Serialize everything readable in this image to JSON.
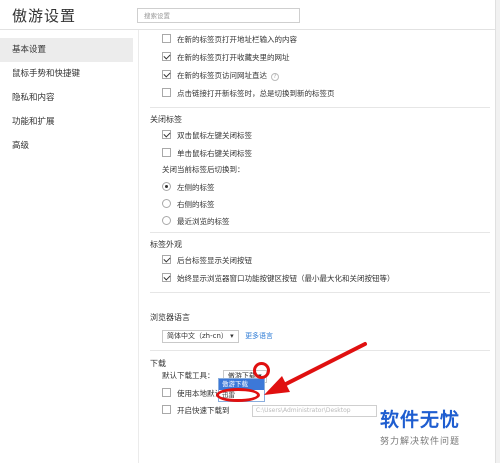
{
  "header": {
    "title": "傲游设置",
    "search_placeholder": "搜索设置"
  },
  "sidebar": {
    "items": [
      {
        "label": "基本设置"
      },
      {
        "label": "鼠标手势和快捷键"
      },
      {
        "label": "隐私和内容"
      },
      {
        "label": "功能和扩展"
      },
      {
        "label": "高级"
      }
    ]
  },
  "tabs_open": {
    "items": [
      {
        "label": "在新的标签页打开地址栏输入的内容",
        "checked": false
      },
      {
        "label": "在新的标签页打开收藏夹里的网址",
        "checked": true
      },
      {
        "label": "在新的标签页访问网址直达",
        "checked": true,
        "help": "?"
      },
      {
        "label": "点击链接打开新标签时，总是切换到新的标签页",
        "checked": false
      }
    ]
  },
  "close_tabs": {
    "title": "关闭标签",
    "items": [
      {
        "label": "双击鼠标左键关闭标签",
        "checked": true
      },
      {
        "label": "单击鼠标右键关闭标签",
        "checked": false
      }
    ],
    "switch_label": "关闭当前标签后切换到：",
    "radios": [
      {
        "label": "左侧的标签",
        "checked": true
      },
      {
        "label": "右侧的标签",
        "checked": false
      },
      {
        "label": "最近浏览的标签",
        "checked": false
      }
    ]
  },
  "tab_appearance": {
    "title": "标签外观",
    "items": [
      {
        "label": "后台标签显示关闭按钮",
        "checked": true
      },
      {
        "label": "始终显示浏览器窗口功能按键区按钮（最小最大化和关闭按钮等）",
        "checked": true
      }
    ]
  },
  "language": {
    "title": "浏览器语言",
    "selected": "简体中文（zh-cn）",
    "more_link": "更多语言"
  },
  "download": {
    "title": "下载",
    "tool_label": "默认下载工具：",
    "tool_selected": "傲游下载",
    "tool_options": [
      "傲游下载",
      "迅雷"
    ],
    "local_item": "使用本地默认",
    "local_item_suffix": "件",
    "open_after": "开启快速下载到",
    "path_value": "C:\\Users\\Administrator\\Desktop"
  },
  "watermark": {
    "main": "软件无忧",
    "sub": "努力解决软件问题"
  },
  "colors": {
    "accent": "#3c78d8",
    "annotation": "#e01010",
    "watermark": "#1e5dd0"
  }
}
